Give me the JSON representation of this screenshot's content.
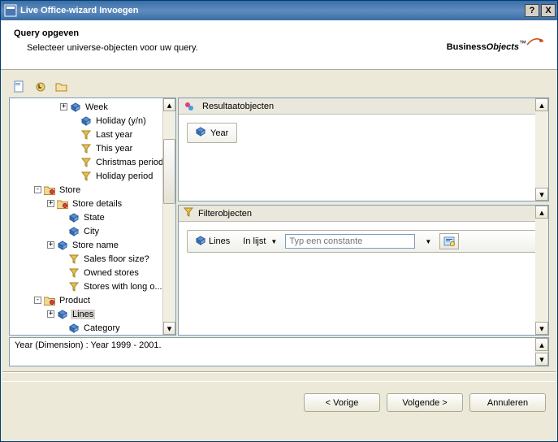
{
  "titlebar": {
    "title": "Live Office-wizard Invoegen",
    "help": "?",
    "close": "X"
  },
  "header": {
    "title": "Query opgeven",
    "subtitle": "Selecteer universe-objecten voor uw query.",
    "logo_business": "Business",
    "logo_objects": "Objects",
    "logo_tm": "™"
  },
  "tree": {
    "items": [
      {
        "indent": 62,
        "exp": "+",
        "icon": "dimension",
        "label": "Week"
      },
      {
        "indent": 75,
        "exp": "",
        "icon": "dimension",
        "label": "Holiday (y/n)"
      },
      {
        "indent": 75,
        "exp": "",
        "icon": "filter",
        "label": "Last year"
      },
      {
        "indent": 75,
        "exp": "",
        "icon": "filter",
        "label": "This year"
      },
      {
        "indent": 75,
        "exp": "",
        "icon": "filter",
        "label": "Christmas period"
      },
      {
        "indent": 75,
        "exp": "",
        "icon": "filter",
        "label": "Holiday period"
      },
      {
        "indent": 30,
        "exp": "-",
        "icon": "class",
        "label": "Store"
      },
      {
        "indent": 46,
        "exp": "+",
        "icon": "class",
        "label": "Store details"
      },
      {
        "indent": 60,
        "exp": "",
        "icon": "dimension",
        "label": "State"
      },
      {
        "indent": 60,
        "exp": "",
        "icon": "dimension",
        "label": "City"
      },
      {
        "indent": 46,
        "exp": "+",
        "icon": "dimension",
        "label": "Store name"
      },
      {
        "indent": 60,
        "exp": "",
        "icon": "filter",
        "label": "Sales floor size?"
      },
      {
        "indent": 60,
        "exp": "",
        "icon": "filter",
        "label": "Owned stores"
      },
      {
        "indent": 60,
        "exp": "",
        "icon": "filter",
        "label": "Stores with long o..."
      },
      {
        "indent": 30,
        "exp": "-",
        "icon": "class",
        "label": "Product"
      },
      {
        "indent": 46,
        "exp": "+",
        "icon": "dimension",
        "label": "Lines",
        "selected": true
      },
      {
        "indent": 60,
        "exp": "",
        "icon": "dimension",
        "label": "Category"
      }
    ]
  },
  "result": {
    "title": "Resultaatobjecten",
    "chip": "Year"
  },
  "filter": {
    "title": "Filterobjecten",
    "field": "Lines",
    "operator": "In lijst",
    "placeholder": "Typ een constante"
  },
  "status": "Year (Dimension) : Year 1999 - 2001.",
  "footer": {
    "back": "< Vorige",
    "next": "Volgende >",
    "cancel": "Annuleren"
  }
}
